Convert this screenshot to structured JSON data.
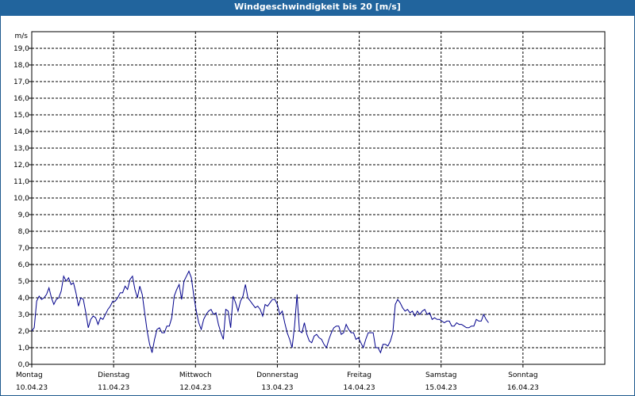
{
  "chart_data": {
    "type": "line",
    "title": "Windgeschwindigkeit bis 20 [m/s]",
    "ylabel": "m/s",
    "ylim": [
      0,
      20
    ],
    "grid": true,
    "yticks": [
      0,
      1,
      2,
      3,
      4,
      5,
      6,
      7,
      8,
      9,
      10,
      11,
      12,
      13,
      14,
      15,
      16,
      17,
      18,
      19
    ],
    "ytick_labels": [
      "0,0",
      "1,0",
      "2,0",
      "3,0",
      "4,0",
      "5,0",
      "6,0",
      "7,0",
      "8,0",
      "9,0",
      "10,0",
      "11,0",
      "12,0",
      "13,0",
      "14,0",
      "15,0",
      "16,0",
      "17,0",
      "18,0",
      "19,0"
    ],
    "xlim": [
      0,
      7
    ],
    "xticks": [
      {
        "x": 0,
        "day": "Montag",
        "date": "10.04.23"
      },
      {
        "x": 1,
        "day": "Dienstag",
        "date": "11.04.23"
      },
      {
        "x": 2,
        "day": "Mittwoch",
        "date": "12.04.23"
      },
      {
        "x": 3,
        "day": "Donnerstag",
        "date": "13.04.23"
      },
      {
        "x": 4,
        "day": "Freitag",
        "date": "14.04.23"
      },
      {
        "x": 5,
        "day": "Samstag",
        "date": "15.04.23"
      },
      {
        "x": 6,
        "day": "Sonntag",
        "date": "16.04.23"
      }
    ],
    "series": [
      {
        "color": "#00008b",
        "points": [
          [
            0.0,
            2.0
          ],
          [
            0.03,
            2.2
          ],
          [
            0.06,
            3.8
          ],
          [
            0.09,
            4.1
          ],
          [
            0.12,
            3.9
          ],
          [
            0.15,
            4.0
          ],
          [
            0.18,
            4.2
          ],
          [
            0.21,
            4.6
          ],
          [
            0.24,
            4.0
          ],
          [
            0.27,
            3.6
          ],
          [
            0.3,
            3.9
          ],
          [
            0.33,
            4.0
          ],
          [
            0.36,
            4.4
          ],
          [
            0.39,
            5.3
          ],
          [
            0.42,
            5.0
          ],
          [
            0.45,
            5.2
          ],
          [
            0.48,
            4.8
          ],
          [
            0.51,
            4.9
          ],
          [
            0.54,
            4.3
          ],
          [
            0.57,
            3.5
          ],
          [
            0.6,
            4.0
          ],
          [
            0.63,
            3.9
          ],
          [
            0.66,
            3.1
          ],
          [
            0.69,
            2.2
          ],
          [
            0.72,
            2.7
          ],
          [
            0.75,
            2.9
          ],
          [
            0.78,
            2.8
          ],
          [
            0.81,
            2.4
          ],
          [
            0.84,
            2.8
          ],
          [
            0.87,
            2.7
          ],
          [
            0.9,
            3.0
          ],
          [
            0.93,
            3.3
          ],
          [
            0.96,
            3.5
          ],
          [
            0.99,
            3.8
          ],
          [
            1.02,
            3.8
          ],
          [
            1.05,
            4.0
          ],
          [
            1.08,
            4.3
          ],
          [
            1.11,
            4.3
          ],
          [
            1.14,
            4.7
          ],
          [
            1.17,
            4.5
          ],
          [
            1.2,
            5.1
          ],
          [
            1.23,
            5.3
          ],
          [
            1.26,
            4.5
          ],
          [
            1.29,
            4.0
          ],
          [
            1.32,
            4.7
          ],
          [
            1.35,
            4.2
          ],
          [
            1.38,
            3.1
          ],
          [
            1.41,
            2.0
          ],
          [
            1.44,
            1.2
          ],
          [
            1.47,
            0.7
          ],
          [
            1.5,
            1.5
          ],
          [
            1.53,
            2.1
          ],
          [
            1.56,
            2.2
          ],
          [
            1.59,
            1.9
          ],
          [
            1.62,
            1.9
          ],
          [
            1.65,
            2.3
          ],
          [
            1.68,
            2.3
          ],
          [
            1.71,
            2.8
          ],
          [
            1.74,
            4.1
          ],
          [
            1.77,
            4.5
          ],
          [
            1.8,
            4.8
          ],
          [
            1.83,
            3.9
          ],
          [
            1.86,
            5.0
          ],
          [
            1.89,
            5.3
          ],
          [
            1.92,
            5.6
          ],
          [
            1.95,
            5.2
          ],
          [
            1.98,
            4.1
          ],
          [
            2.01,
            3.2
          ],
          [
            2.04,
            2.5
          ],
          [
            2.07,
            2.1
          ],
          [
            2.1,
            2.7
          ],
          [
            2.13,
            3.0
          ],
          [
            2.16,
            3.2
          ],
          [
            2.19,
            3.3
          ],
          [
            2.22,
            3.0
          ],
          [
            2.25,
            3.1
          ],
          [
            2.28,
            2.4
          ],
          [
            2.31,
            1.9
          ],
          [
            2.34,
            1.5
          ],
          [
            2.37,
            3.3
          ],
          [
            2.4,
            3.2
          ],
          [
            2.43,
            2.2
          ],
          [
            2.46,
            4.1
          ],
          [
            2.49,
            3.7
          ],
          [
            2.52,
            3.2
          ],
          [
            2.55,
            3.8
          ],
          [
            2.58,
            4.1
          ],
          [
            2.61,
            4.8
          ],
          [
            2.64,
            4.0
          ],
          [
            2.67,
            3.8
          ],
          [
            2.7,
            3.6
          ],
          [
            2.73,
            3.4
          ],
          [
            2.76,
            3.5
          ],
          [
            2.79,
            3.3
          ],
          [
            2.82,
            2.9
          ],
          [
            2.85,
            3.6
          ],
          [
            2.88,
            3.5
          ],
          [
            2.91,
            3.7
          ],
          [
            2.94,
            3.9
          ],
          [
            2.97,
            3.9
          ],
          [
            3.0,
            3.6
          ],
          [
            3.03,
            3.0
          ],
          [
            3.06,
            3.2
          ],
          [
            3.09,
            2.5
          ],
          [
            3.12,
            1.9
          ],
          [
            3.15,
            1.5
          ],
          [
            3.18,
            1.0
          ],
          [
            3.21,
            2.3
          ],
          [
            3.24,
            4.2
          ],
          [
            3.27,
            2.0
          ],
          [
            3.3,
            1.9
          ],
          [
            3.33,
            2.5
          ],
          [
            3.36,
            1.8
          ],
          [
            3.39,
            1.4
          ],
          [
            3.42,
            1.3
          ],
          [
            3.45,
            1.7
          ],
          [
            3.48,
            1.8
          ],
          [
            3.51,
            1.6
          ],
          [
            3.54,
            1.5
          ],
          [
            3.57,
            1.2
          ],
          [
            3.6,
            1.0
          ],
          [
            3.63,
            1.5
          ],
          [
            3.66,
            1.9
          ],
          [
            3.69,
            2.2
          ],
          [
            3.72,
            2.3
          ],
          [
            3.75,
            2.3
          ],
          [
            3.78,
            1.8
          ],
          [
            3.81,
            1.9
          ],
          [
            3.84,
            2.4
          ],
          [
            3.87,
            2.1
          ],
          [
            3.9,
            1.9
          ],
          [
            3.93,
            1.9
          ],
          [
            3.96,
            1.5
          ],
          [
            3.99,
            1.6
          ],
          [
            4.02,
            1.3
          ],
          [
            4.05,
            1.0
          ],
          [
            4.08,
            1.5
          ],
          [
            4.11,
            1.9
          ],
          [
            4.14,
            1.9
          ],
          [
            4.17,
            1.9
          ],
          [
            4.2,
            1.0
          ],
          [
            4.23,
            1.0
          ],
          [
            4.26,
            0.7
          ],
          [
            4.29,
            1.2
          ],
          [
            4.32,
            1.2
          ],
          [
            4.35,
            1.1
          ],
          [
            4.38,
            1.4
          ],
          [
            4.41,
            1.9
          ],
          [
            4.44,
            3.6
          ],
          [
            4.47,
            3.9
          ],
          [
            4.5,
            3.7
          ],
          [
            4.53,
            3.4
          ],
          [
            4.56,
            3.2
          ],
          [
            4.59,
            3.3
          ],
          [
            4.62,
            3.1
          ],
          [
            4.65,
            3.2
          ],
          [
            4.68,
            2.9
          ],
          [
            4.71,
            3.2
          ],
          [
            4.74,
            3.0
          ],
          [
            4.77,
            3.2
          ],
          [
            4.8,
            3.3
          ],
          [
            4.83,
            3.0
          ],
          [
            4.86,
            3.1
          ],
          [
            4.89,
            2.7
          ],
          [
            4.92,
            2.8
          ],
          [
            4.95,
            2.7
          ],
          [
            4.98,
            2.7
          ],
          [
            5.01,
            2.6
          ],
          [
            5.04,
            2.5
          ],
          [
            5.07,
            2.6
          ],
          [
            5.1,
            2.6
          ],
          [
            5.13,
            2.3
          ],
          [
            5.16,
            2.3
          ],
          [
            5.19,
            2.5
          ],
          [
            5.22,
            2.4
          ],
          [
            5.25,
            2.4
          ],
          [
            5.28,
            2.3
          ],
          [
            5.31,
            2.2
          ],
          [
            5.34,
            2.2
          ],
          [
            5.37,
            2.3
          ],
          [
            5.4,
            2.3
          ],
          [
            5.43,
            2.7
          ],
          [
            5.46,
            2.6
          ],
          [
            5.49,
            2.6
          ],
          [
            5.52,
            3.0
          ],
          [
            5.55,
            2.7
          ],
          [
            5.58,
            2.5
          ]
        ]
      }
    ]
  }
}
